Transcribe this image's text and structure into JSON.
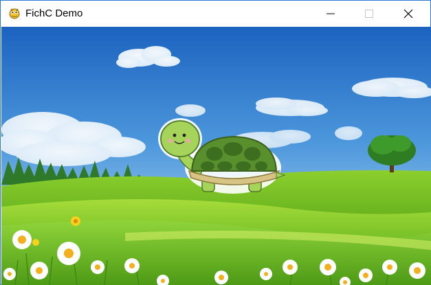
{
  "window": {
    "title": "FichC Demo",
    "app_icon": "snake-icon",
    "controls": {
      "minimize_icon": "minimize-icon",
      "maximize_icon": "maximize-icon",
      "close_icon": "close-icon"
    }
  },
  "scene": {
    "sprite": "turtle",
    "background": "sky-meadow-with-flowers",
    "colors": {
      "sky_top": "#1e6fc8",
      "sky_bottom": "#bfe3f8",
      "grass": "#7cc42a",
      "turtle_shell": "#5a8f2e",
      "turtle_skin": "#a6d35a"
    }
  }
}
